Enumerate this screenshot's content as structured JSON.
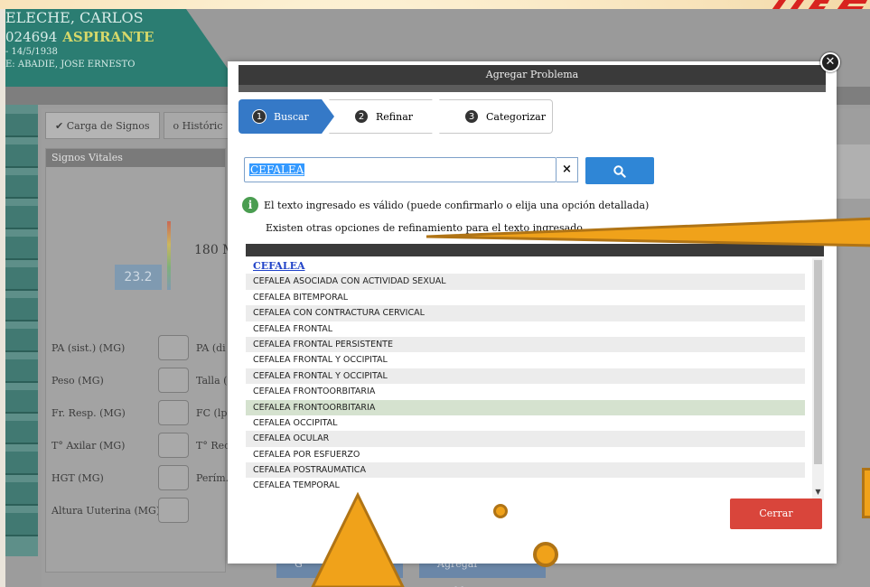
{
  "patient": {
    "name": "ELECHE, CARLOS",
    "id": "024694",
    "status": "ASPIRANTE",
    "dob": "- 14/5/1938",
    "doctor": "E: ABADIE, JOSE ERNESTO"
  },
  "background": {
    "tabs": [
      {
        "label": "✔ Carga de Signos"
      },
      {
        "label": "o Históric"
      }
    ],
    "signos_title": "Signos Vitales",
    "bmi_value": "23.2",
    "hr_value": "180 M",
    "fields": [
      {
        "label": "PA (sist.) (MG)",
        "label2": "PA (di"
      },
      {
        "label": "Peso (MG)",
        "label2": "Talla ("
      },
      {
        "label": "Fr. Resp. (MG)",
        "label2": "FC (lp"
      },
      {
        "label": "T° Axilar (MG)",
        "label2": "T° Rec"
      },
      {
        "label": "HGT (MG)",
        "label2": "Perím."
      },
      {
        "label": "Altura Uuterina (MG)",
        "label2": ""
      }
    ],
    "bottom_buttons": [
      "G",
      "Agregar Problema"
    ]
  },
  "modal": {
    "title": "Agregar Problema",
    "close_icon": "close-circle-icon",
    "steps": [
      {
        "num": "1",
        "label": "Buscar",
        "active": true
      },
      {
        "num": "2",
        "label": "Refinar",
        "active": false
      },
      {
        "num": "3",
        "label": "Categorizar",
        "active": false
      }
    ],
    "search": {
      "value": "CEFALEA",
      "clear_label": "×",
      "search_icon": "search-icon"
    },
    "valid_message": "El texto ingresado es válido (puede confirmarlo o elija una opción detallada)",
    "other_message": "Existen otras opciones de refinamiento para el texto ingresado.",
    "results": [
      "CEFALEA",
      "CEFALEA ASOCIADA CON ACTIVIDAD SEXUAL",
      "CEFALEA BITEMPORAL",
      "CEFALEA CON CONTRACTURA CERVICAL",
      "CEFALEA FRONTAL",
      "CEFALEA FRONTAL PERSISTENTE",
      "CEFALEA FRONTAL Y OCCIPITAL",
      "CEFALEA FRONTAL Y OCCIPITAL",
      "CEFALEA FRONTOORBITARIA",
      "CEFALEA FRONTOORBITARIA",
      "CEFALEA OCCIPITAL",
      "CEFALEA OCULAR",
      "CEFALEA POR ESFUERZO",
      "CEFALEA POSTRAUMATICA",
      "CEFALEA TEMPORAL"
    ],
    "highlighted_index": 9,
    "close_button": "Cerrar"
  },
  "colors": {
    "accent_blue": "#2f86d6",
    "close_red": "#d9453b",
    "header_teal": "#2b7d72",
    "annotation_orange": "#f0a21a",
    "logo_red": "#d8231f"
  }
}
